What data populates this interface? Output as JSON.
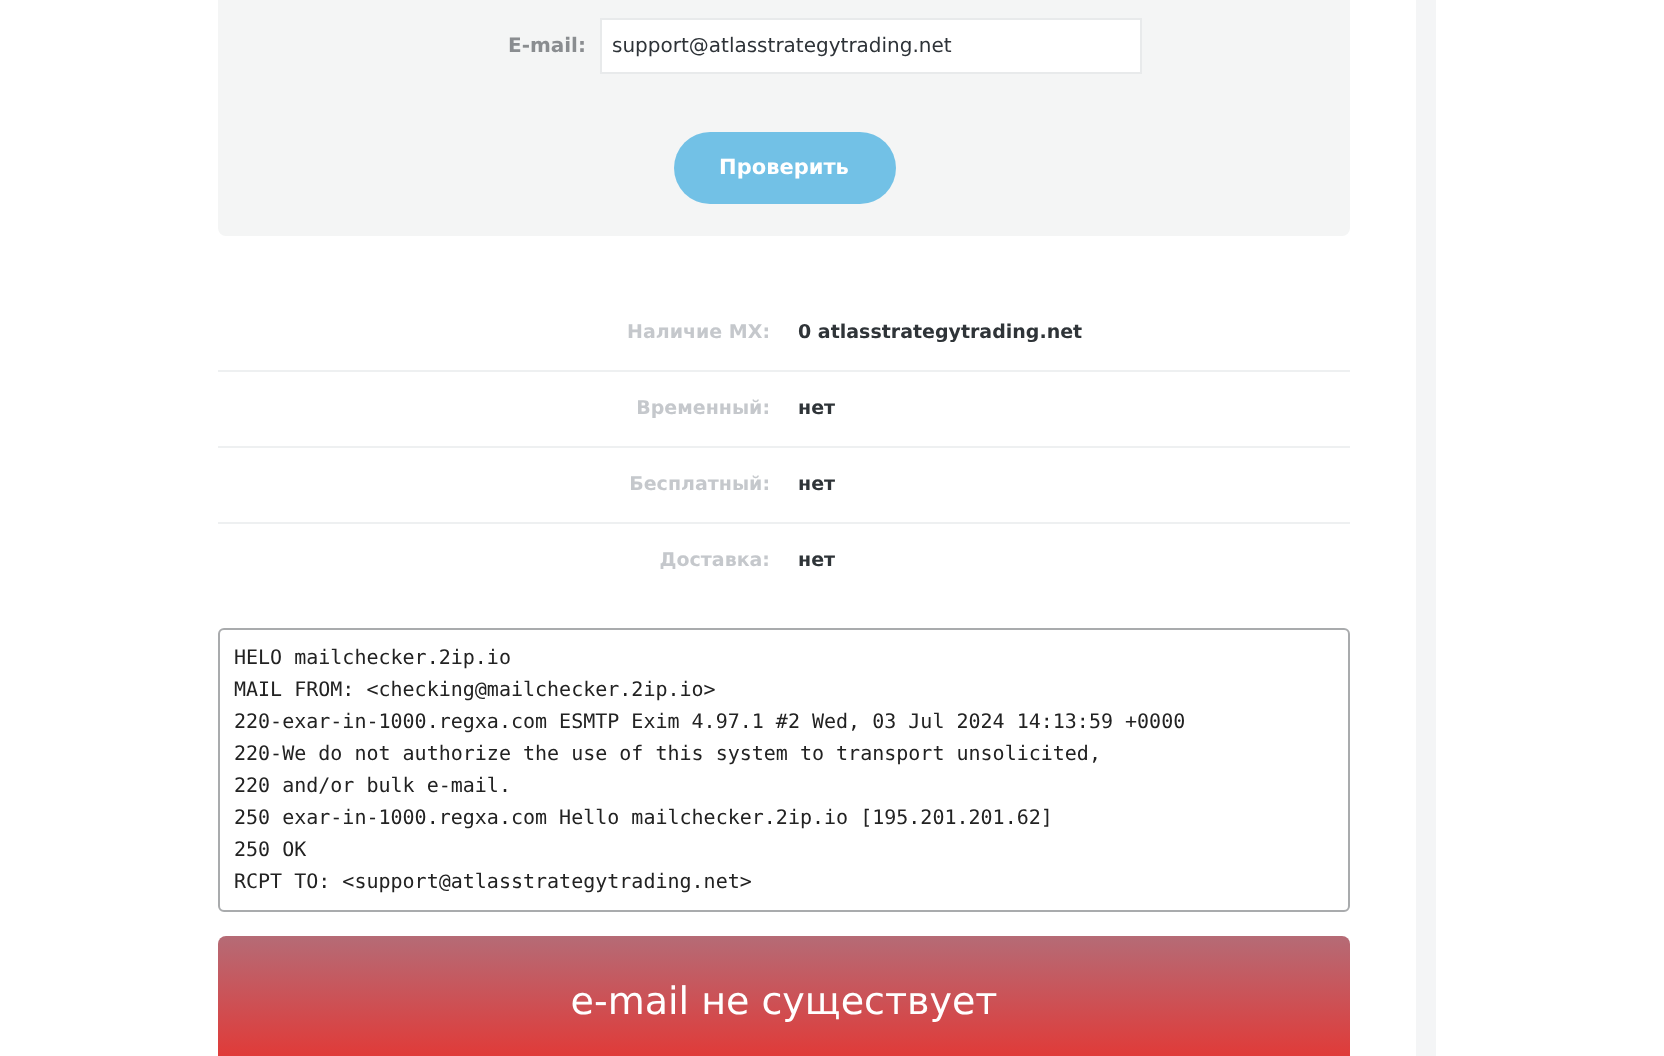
{
  "check_form": {
    "email_label": "E-mail:",
    "email_value": "support@atlasstrategytrading.net",
    "submit_button": "Проверить"
  },
  "results": [
    {
      "label": "Наличие MX:",
      "value": "0 atlasstrategytrading.net"
    },
    {
      "label": "Временный:",
      "value": "нет"
    },
    {
      "label": "Бесплатный:",
      "value": "нет"
    },
    {
      "label": "Доставка:",
      "value": "нет"
    }
  ],
  "smtp_log": [
    "HELO mailchecker.2ip.io",
    "MAIL FROM: <checking@mailchecker.2ip.io>",
    "220-exar-in-1000.regxa.com ESMTP Exim 4.97.1 #2 Wed, 03 Jul 2024 14:13:59 +0000",
    "220-We do not authorize the use of this system to transport unsolicited,",
    "220 and/or bulk e-mail.",
    "250 exar-in-1000.regxa.com Hello mailchecker.2ip.io [195.201.201.62]",
    "250 OK",
    "RCPT TO: <support@atlasstrategytrading.net>"
  ],
  "verdict": {
    "kind": "error",
    "text": "e-mail не существует"
  }
}
